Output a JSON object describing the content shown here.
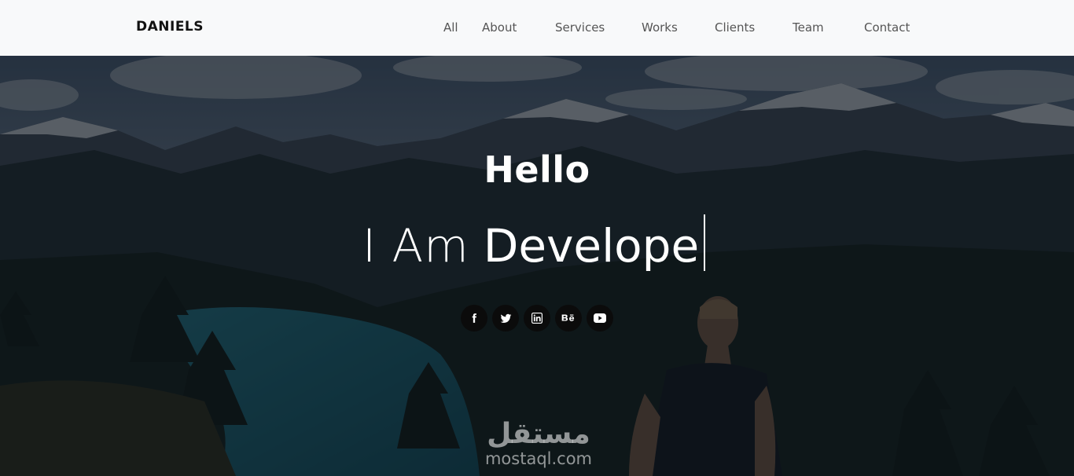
{
  "brand": "DANIELS",
  "nav": {
    "items": [
      "All",
      "About",
      "Services",
      "Works",
      "Clients",
      "Team",
      "Contact"
    ]
  },
  "hero": {
    "greeting": "Hello",
    "prefix": "I Am",
    "typed_word": "Develope"
  },
  "socials": [
    {
      "name": "facebook-icon",
      "glyph": "f"
    },
    {
      "name": "twitter-icon",
      "glyph": "twitter"
    },
    {
      "name": "linkedin-icon",
      "glyph": "in"
    },
    {
      "name": "behance-icon",
      "glyph": "Bē"
    },
    {
      "name": "youtube-icon",
      "glyph": "youtube"
    }
  ],
  "watermark": {
    "arabic": "مستقل",
    "latin": "mostaql.com"
  },
  "colors": {
    "nav_bg": "#f8f9fa",
    "overlay": "rgba(5,12,20,0.62)",
    "social_bg": "#0b0b0b"
  }
}
